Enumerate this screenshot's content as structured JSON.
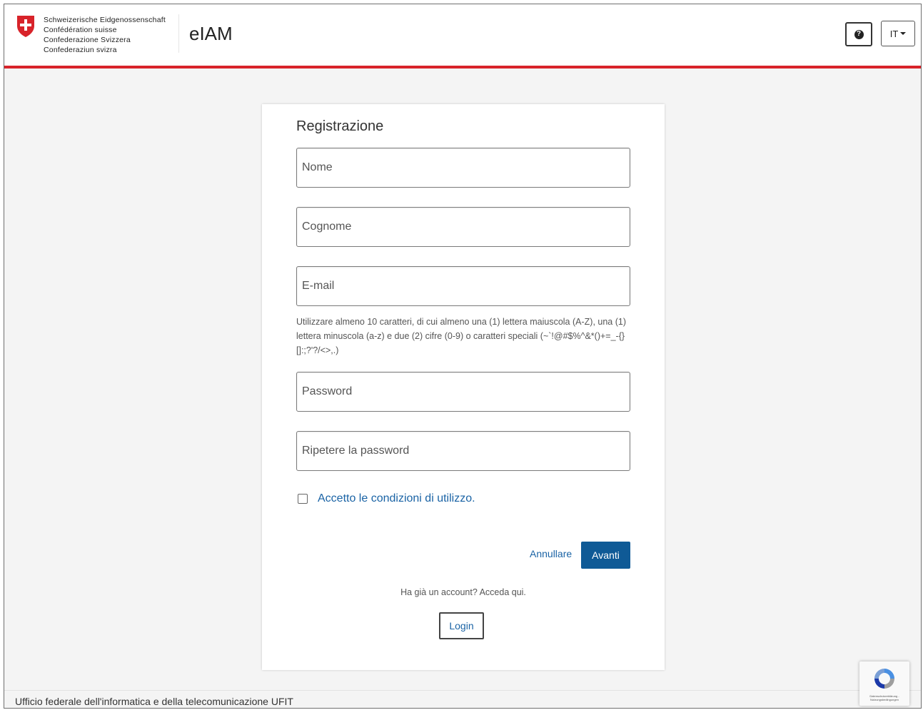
{
  "header": {
    "federation_lines": [
      "Schweizerische Eidgenossenschaft",
      "Confédération suisse",
      "Confederazione Svizzera",
      "Confederaziun svizra"
    ],
    "app_title": "eIAM",
    "help_icon": "question-circle-icon",
    "language": "IT"
  },
  "form": {
    "title": "Registrazione",
    "fields": {
      "name_placeholder": "Nome",
      "surname_placeholder": "Cognome",
      "email_placeholder": "E-mail",
      "password_hint": "Utilizzare almeno 10 caratteri, di cui almeno una (1) lettera maiuscola (A-Z), una (1) lettera minuscola (a-z) e due (2) cifre (0-9) o caratteri speciali (~`!@#$%^&*()+=_-{}[]:;?'?/<>,.)",
      "password_placeholder": "Password",
      "repeat_password_placeholder": "Ripetere la password"
    },
    "terms_label": "Accetto le condizioni di utilizzo.",
    "cancel_label": "Annullare",
    "next_label": "Avanti",
    "account_question": "Ha già un account? Acceda qui.",
    "login_label": "Login"
  },
  "footer": {
    "text": "Ufficio federale dell'informatica e della telecomunicazione UFIT"
  },
  "recaptcha": {
    "text": "Datenschutzerklärung - Nutzungsbedingungen"
  },
  "colors": {
    "accent_red": "#d8232a",
    "primary_blue": "#0f5a96",
    "link_blue": "#1a63a5"
  }
}
